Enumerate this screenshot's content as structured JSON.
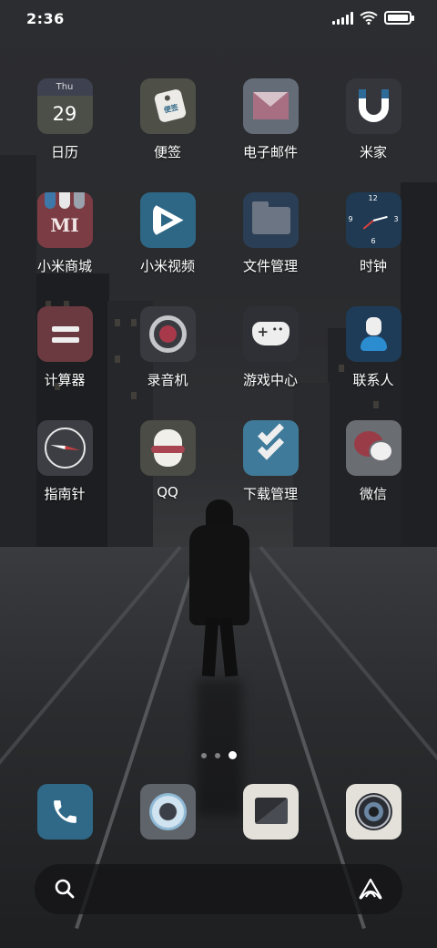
{
  "status_bar": {
    "time": "2:36",
    "battery_level": 1.0
  },
  "apps": [
    {
      "label": "日历",
      "icon": "calendar-icon",
      "weekday": "Thu",
      "day": "29"
    },
    {
      "label": "便签",
      "icon": "notes-icon",
      "badge_text": "便签"
    },
    {
      "label": "电子邮件",
      "icon": "mail-icon"
    },
    {
      "label": "米家",
      "icon": "mijia-icon"
    },
    {
      "label": "小米商城",
      "icon": "mi-store-icon",
      "mark": "MI"
    },
    {
      "label": "小米视频",
      "icon": "mi-video-icon"
    },
    {
      "label": "文件管理",
      "icon": "file-manager-icon"
    },
    {
      "label": "时钟",
      "icon": "clock-icon",
      "numerals": [
        "12",
        "3",
        "6",
        "9"
      ]
    },
    {
      "label": "计算器",
      "icon": "calculator-icon"
    },
    {
      "label": "录音机",
      "icon": "recorder-icon"
    },
    {
      "label": "游戏中心",
      "icon": "game-center-icon"
    },
    {
      "label": "联系人",
      "icon": "contacts-icon"
    },
    {
      "label": "指南针",
      "icon": "compass-icon"
    },
    {
      "label": "QQ",
      "icon": "qq-icon"
    },
    {
      "label": "下载管理",
      "icon": "download-manager-icon"
    },
    {
      "label": "微信",
      "icon": "wechat-icon"
    }
  ],
  "pager": {
    "pages": 3,
    "active_page": 3
  },
  "dock": [
    {
      "icon": "phone-icon"
    },
    {
      "icon": "browser-icon"
    },
    {
      "icon": "messages-icon"
    },
    {
      "icon": "camera-icon"
    }
  ],
  "search": {
    "placeholder": "",
    "left_icon": "search-icon",
    "right_icon": "voice-assistant-icon"
  },
  "colors": {
    "accent_blue": "#2f6987",
    "accent_red": "#a8394a",
    "label": "#ffffff"
  }
}
